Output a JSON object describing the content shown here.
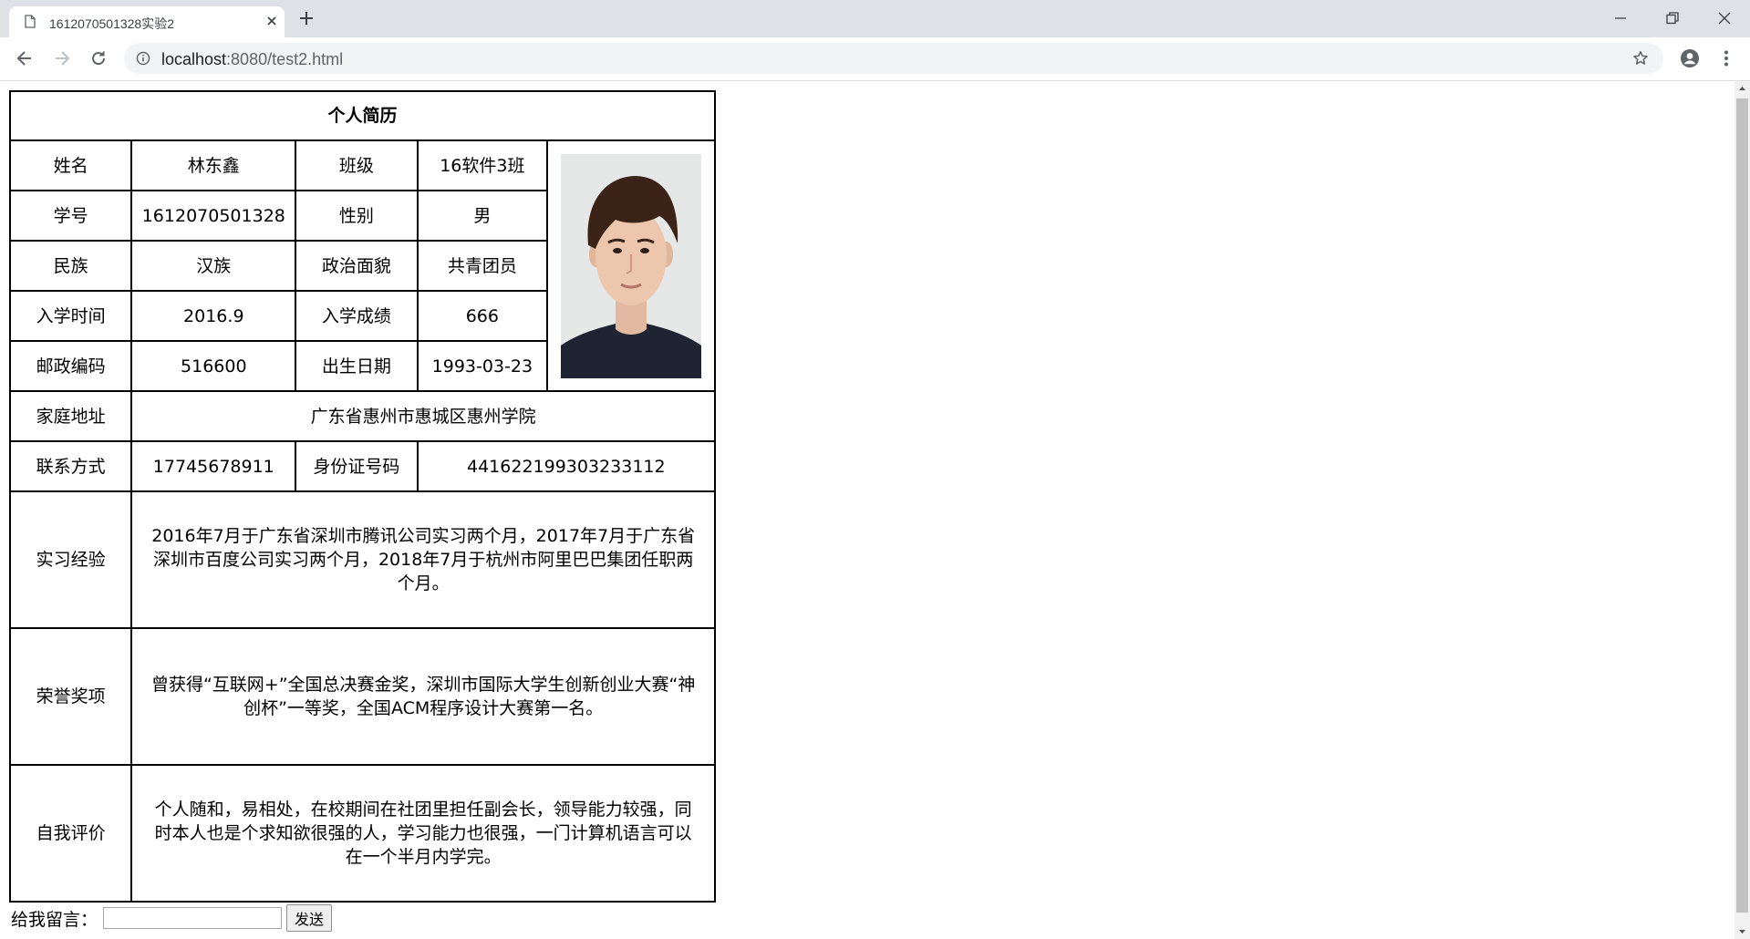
{
  "browser": {
    "tab_title": "1612070501328实验2",
    "url_host": "localhost",
    "url_rest": ":8080/test2.html"
  },
  "resume": {
    "title": "个人简历",
    "labels": {
      "name": "姓名",
      "class": "班级",
      "student_id": "学号",
      "gender": "性别",
      "ethnicity": "民族",
      "political_status": "政治面貌",
      "enroll_time": "入学时间",
      "enroll_score": "入学成绩",
      "postal_code": "邮政编码",
      "birth_date": "出生日期",
      "address": "家庭地址",
      "contact": "联系方式",
      "id_number": "身份证号码",
      "internship": "实习经验",
      "honors": "荣誉奖项",
      "self_eval": "自我评价"
    },
    "values": {
      "name": "林东鑫",
      "class": "16软件3班",
      "student_id": "1612070501328",
      "gender": "男",
      "ethnicity": "汉族",
      "political_status": "共青团员",
      "enroll_time": "2016.9",
      "enroll_score": "666",
      "postal_code": "516600",
      "birth_date": "1993-03-23",
      "address": "广东省惠州市惠城区惠州学院",
      "contact": "17745678911",
      "id_number": "441622199303233112",
      "internship": "2016年7月于广东省深圳市腾讯公司实习两个月，2017年7月于广东省深圳市百度公司实习两个月，2018年7月于杭州市阿里巴巴集团任职两个月。",
      "honors": "曾获得“互联网+”全国总决赛金奖，深圳市国际大学生创新创业大赛“神创杯”一等奖，全国ACM程序设计大赛第一名。",
      "self_eval": "个人随和，易相处，在校期间在社团里担任副会长，领导能力较强，同时本人也是个求知欲很强的人，学习能力也很强，一门计算机语言可以在一个半月内学完。"
    }
  },
  "message": {
    "label": "给我留言：",
    "input_value": "",
    "button_label": "发送"
  }
}
